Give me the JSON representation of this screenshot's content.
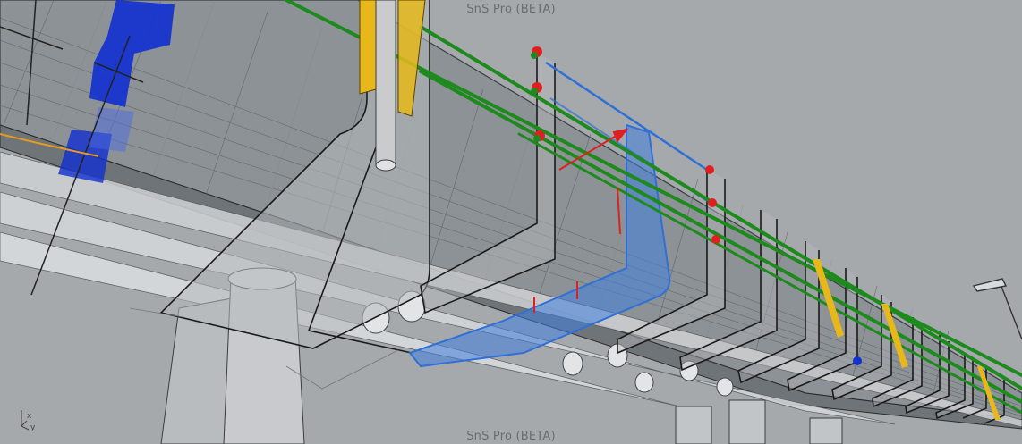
{
  "viewport": {
    "title_top": "SnS Pro (BETA)",
    "title_bottom": "SnS Pro (BETA)",
    "background": "#a6a9ac",
    "axis_x": "x",
    "axis_y": "y"
  },
  "scene": {
    "object_type": "pipe-rack-3d-model",
    "colors": {
      "rail_green": "#1e8a1e",
      "selected_blue": "#2f6fd6",
      "support_yellow": "#e8b81a",
      "pipe_gray": "#c8cacc",
      "handle_red": "#e02020",
      "marker_blue": "#1030d0",
      "wire_orange": "#e89a20"
    }
  }
}
